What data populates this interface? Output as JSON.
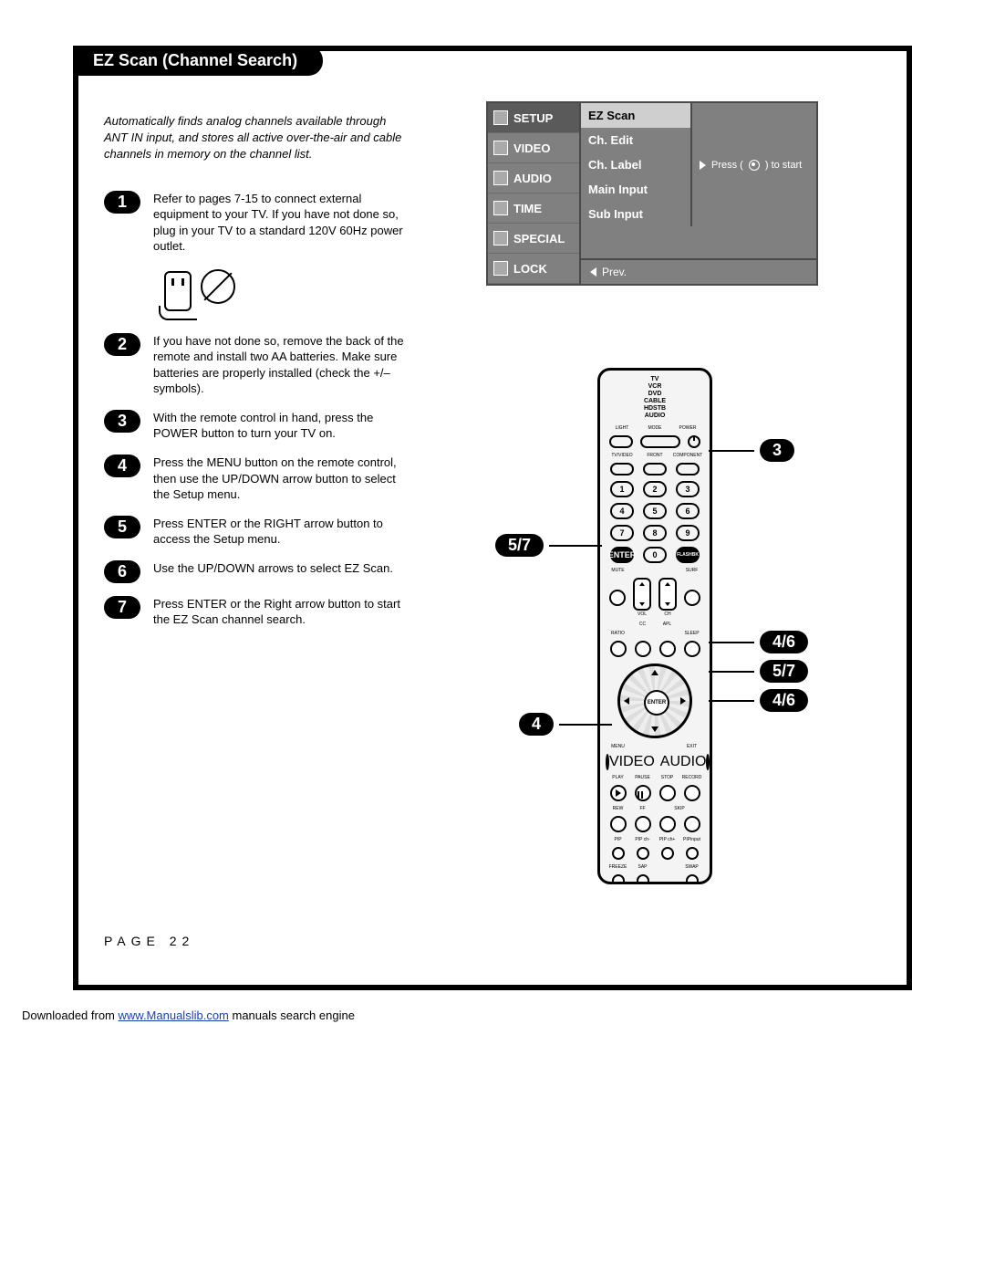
{
  "title": "EZ Scan (Channel Search)",
  "intro": "Automatically finds analog channels available through ANT IN input, and stores all active over-the-air and cable channels in memory on the channel list.",
  "osd": {
    "tabs": [
      "SETUP",
      "VIDEO",
      "AUDIO",
      "TIME",
      "SPECIAL",
      "LOCK"
    ],
    "items": [
      "EZ Scan",
      "Ch. Edit",
      "Ch. Label",
      "Main Input",
      "Sub Input"
    ],
    "hint_prefix": "Press (",
    "hint_suffix": ") to start",
    "prev": "Prev."
  },
  "steps": [
    {
      "n": "1",
      "t": "Refer to pages 7-15 to connect external equipment to your TV. If you have not done so, plug in your TV to a standard 120V 60Hz power outlet."
    },
    {
      "n": "2",
      "t": "If you have not done so, remove the back of the remote and install two AA batteries. Make sure batteries are properly installed (check the +/– symbols)."
    },
    {
      "n": "3",
      "t": "With the remote control in hand, press the POWER button to turn your TV on."
    },
    {
      "n": "4",
      "t": "Press the MENU button on the remote control, then use the UP/DOWN arrow button to select the Setup menu."
    },
    {
      "n": "5",
      "t": "Press ENTER or the RIGHT arrow button to access the Setup menu."
    },
    {
      "n": "6",
      "t": "Use the UP/DOWN arrows to select EZ Scan."
    },
    {
      "n": "7",
      "t": "Press ENTER or the Right arrow button to start the EZ Scan channel search."
    }
  ],
  "remote": {
    "modes": "TV\nVCR\nDVD\nCABLE\nHDSTB\nAUDIO",
    "top_labels": {
      "light": "LIGHT",
      "mode": "MODE",
      "power": "POWER"
    },
    "sel_labels": {
      "tvvideo": "TV/VIDEO",
      "front": "FRONT",
      "component": "COMPONENT"
    },
    "numpad": [
      "1",
      "2",
      "3",
      "4",
      "5",
      "6",
      "7",
      "8",
      "9",
      "0"
    ],
    "enter_lbl": "ENTER",
    "flashbk": "FLASHBK",
    "mute": "MUTE",
    "surf": "SURF",
    "vol": "VOL",
    "ch": "CH",
    "cc": "CC",
    "apl": "APL",
    "ratio": "RATIO",
    "sleep": "SLEEP",
    "menu": "MENU",
    "exit": "EXIT",
    "video": "VIDEO",
    "audio": "AUDIO",
    "play": "PLAY",
    "pause": "PAUSE",
    "stop": "STOP",
    "record": "RECORD",
    "rew": "REW",
    "ff": "FF",
    "skip": "SKIP",
    "pip": "PIP",
    "pipch-": "PIP ch-",
    "pipch+": "PIP ch+",
    "pipinput": "PIPinput",
    "freeze": "FREEZE",
    "sap": "SAP",
    "swap": "SWAP"
  },
  "callouts": {
    "c3": "3",
    "c57a": "5/7",
    "c46a": "4/6",
    "c57b": "5/7",
    "c46b": "4/6",
    "c4": "4"
  },
  "page_label": "PAGE 22",
  "download": {
    "prefix": "Downloaded from ",
    "link": "www.Manualslib.com",
    "suffix": " manuals search engine"
  }
}
